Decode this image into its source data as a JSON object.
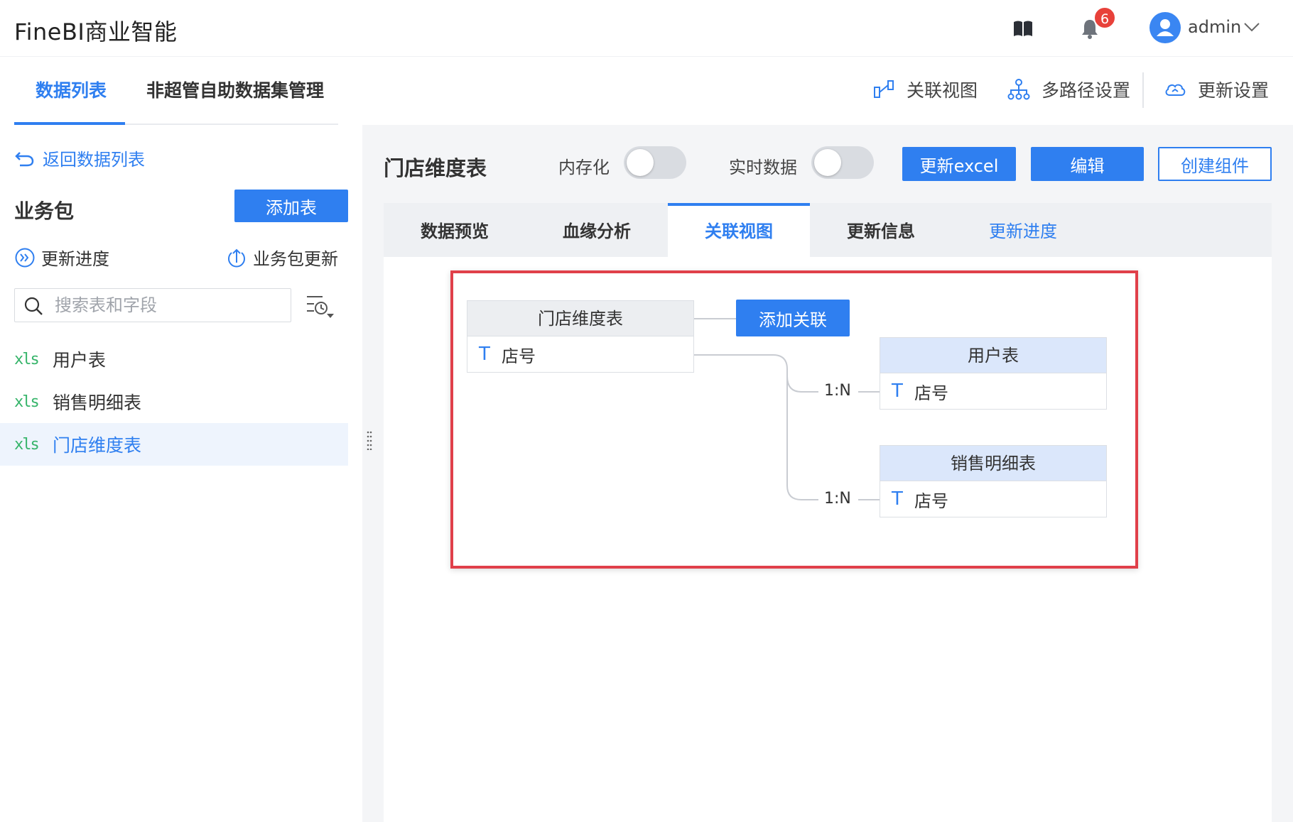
{
  "app": {
    "title": "FineBI商业智能"
  },
  "header": {
    "notification_count": "6",
    "user_name": "admin"
  },
  "tabs": [
    {
      "label": "数据列表",
      "active": true
    },
    {
      "label": "非超管自助数据集管理",
      "active": false
    }
  ],
  "toolbar": {
    "relation_view": "关联视图",
    "multipath": "多路径设置",
    "update_settings": "更新设置"
  },
  "sidebar": {
    "back_label": "返回数据列表",
    "section_title": "业务包",
    "add_table_label": "添加表",
    "update_progress_label": "更新进度",
    "package_update_label": "业务包更新",
    "search_placeholder": "搜索表和字段",
    "tables": [
      {
        "tag": "xls",
        "name": "用户表",
        "selected": false
      },
      {
        "tag": "xls",
        "name": "销售明细表",
        "selected": false
      },
      {
        "tag": "xls",
        "name": "门店维度表",
        "selected": true
      }
    ]
  },
  "main": {
    "title": "门店维度表",
    "memory_label": "内存化",
    "realtime_label": "实时数据",
    "update_excel_label": "更新excel",
    "edit_label": "编辑",
    "create_component_label": "创建组件",
    "subtabs": [
      {
        "label": "数据预览",
        "active": false
      },
      {
        "label": "血缘分析",
        "active": false
      },
      {
        "label": "关联视图",
        "active": true
      },
      {
        "label": "更新信息",
        "active": false
      },
      {
        "label": "更新进度",
        "active": false,
        "link": true
      }
    ]
  },
  "relation_view": {
    "add_relation_label": "添加关联",
    "source_table": {
      "name": "门店维度表",
      "field_type": "T",
      "field": "店号"
    },
    "targets": [
      {
        "name": "用户表",
        "field_type": "T",
        "field": "店号",
        "cardinality": "1:N"
      },
      {
        "name": "销售明细表",
        "field_type": "T",
        "field": "店号",
        "cardinality": "1:N"
      }
    ]
  },
  "colors": {
    "accent": "#2f7ff0",
    "highlight": "#e0404a",
    "xls": "#36b46a",
    "badge": "#e8413a"
  }
}
